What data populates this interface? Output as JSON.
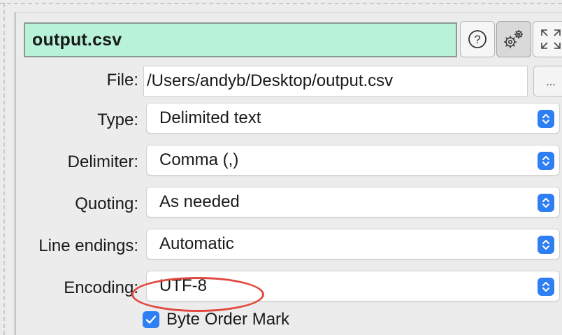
{
  "window": {
    "title": "output.csv"
  },
  "toolbar": {
    "help": {
      "icon": "help-icon"
    },
    "settings": {
      "icon": "gear-icon"
    },
    "expand": {
      "icon": "expand-icon"
    }
  },
  "form": {
    "file": {
      "label": "File:",
      "value": "/Users/andyb/Desktop/output.csv",
      "browse_label": "..."
    },
    "type": {
      "label": "Type:",
      "value": "Delimited text"
    },
    "delimiter": {
      "label": "Delimiter:",
      "value": "Comma (,)"
    },
    "quoting": {
      "label": "Quoting:",
      "value": "As needed"
    },
    "line_endings": {
      "label": "Line endings:",
      "value": "Automatic"
    },
    "encoding": {
      "label": "Encoding:",
      "value": "UTF-8"
    },
    "bom": {
      "label": "Byte Order Mark",
      "checked": true
    }
  },
  "colors": {
    "title_bg": "#b8f2d8",
    "accent": "#2f7ff4",
    "highlight": "#e2473d"
  }
}
